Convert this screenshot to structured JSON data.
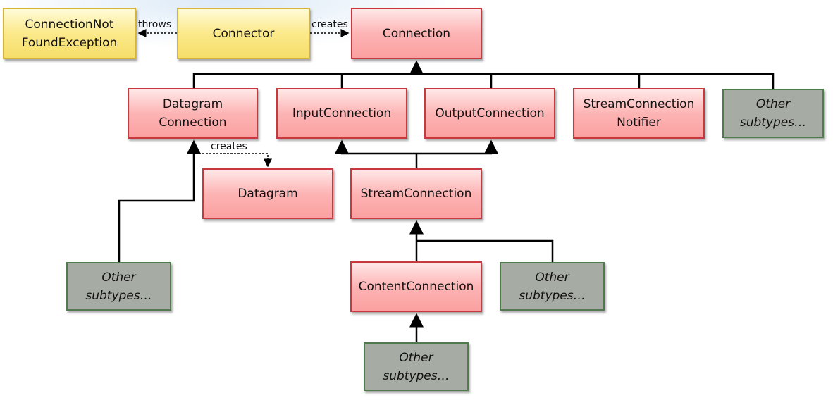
{
  "nodes": {
    "connection_not_found_exception": "ConnectionNot FoundException",
    "connector": "Connector",
    "connection": "Connection",
    "datagram_connection": "Datagram Connection",
    "input_connection": "InputConnection",
    "output_connection": "OutputConnection",
    "stream_connection_notifier": "StreamConnection Notifier",
    "other_subtypes_1": "Other subtypes…",
    "datagram": "Datagram",
    "stream_connection": "StreamConnection",
    "other_subtypes_2": "Other subtypes…",
    "content_connection": "ContentConnection",
    "other_subtypes_3": "Other subtypes…",
    "other_subtypes_4": "Other subtypes…"
  },
  "edges": {
    "throws": "throws",
    "creates_connection": "creates",
    "creates_datagram": "creates"
  },
  "colors": {
    "interface": "#fba0a0",
    "class": "#f6de6a",
    "other": "#a6aca3"
  }
}
